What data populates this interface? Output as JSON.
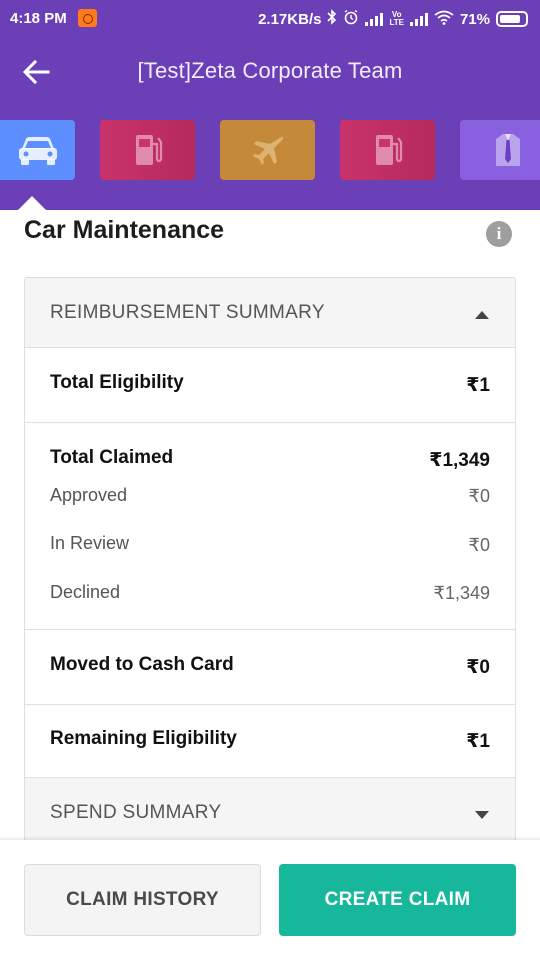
{
  "status_bar": {
    "time": "4:18 PM",
    "network_speed": "2.17KB/s",
    "battery": "71%",
    "icons": [
      "app-notification-icon",
      "bluetooth-icon",
      "alarm-icon",
      "signal-icon",
      "volte-icon",
      "signal-icon",
      "wifi-icon",
      "battery-icon"
    ]
  },
  "toolbar": {
    "title": "[Test]Zeta Corporate Team",
    "back_icon": "arrow-left-icon"
  },
  "categories": [
    {
      "icon": "car-icon",
      "active": true
    },
    {
      "icon": "fuel-pump-icon",
      "active": false
    },
    {
      "icon": "airplane-icon",
      "active": false
    },
    {
      "icon": "fuel-pump-icon",
      "active": false
    },
    {
      "icon": "shirt-tie-icon",
      "active": false
    }
  ],
  "page": {
    "title": "Car Maintenance",
    "info_icon": "i"
  },
  "reimbursement_summary": {
    "title": "REIMBURSEMENT SUMMARY",
    "total_eligibility": {
      "label": "Total Eligibility",
      "value": "₹1"
    },
    "total_claimed": {
      "label": "Total Claimed",
      "value": "₹1,349"
    },
    "approved": {
      "label": "Approved",
      "value": "₹0"
    },
    "in_review": {
      "label": "In Review",
      "value": "₹0"
    },
    "declined": {
      "label": "Declined",
      "value": "₹1,349"
    },
    "moved_to_cash_card": {
      "label": "Moved to Cash Card",
      "value": "₹0"
    },
    "remaining_eligibility": {
      "label": "Remaining Eligibility",
      "value": "₹1"
    }
  },
  "spend_summary": {
    "title": "SPEND SUMMARY"
  },
  "actions": {
    "claim_history": "CLAIM HISTORY",
    "create_claim": "CREATE CLAIM"
  },
  "colors": {
    "header": "#6b3fb5",
    "accent": "#16b79a",
    "active_category": "#5e8fff"
  }
}
